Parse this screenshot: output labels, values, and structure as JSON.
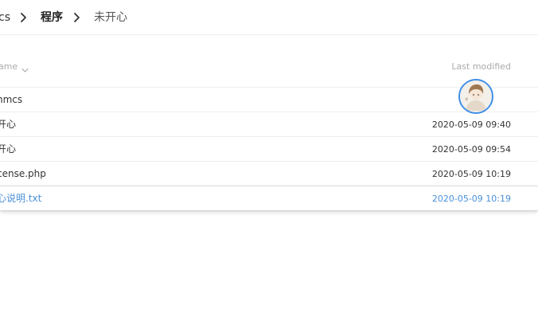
{
  "breadcrumb": {
    "items": [
      "cs",
      "程序",
      "未开心"
    ],
    "separator_icon": "chevron-right-icon"
  },
  "table": {
    "columns": {
      "name": "ame",
      "modified": "Last modified"
    },
    "sort_icon": "chevron-down-icon",
    "rows": [
      {
        "name": "nmcs",
        "modified": ""
      },
      {
        "name": "开心",
        "modified": "2020-05-09 09:40"
      },
      {
        "name": "开心",
        "modified": "2020-05-09 09:54"
      },
      {
        "name": "cense.php",
        "modified": "2020-05-09 10:19"
      },
      {
        "name": "心说明.txt",
        "modified": "2020-05-09 10:19",
        "selected": true
      }
    ]
  },
  "colors": {
    "accent": "#4a90d9",
    "avatar_ring": "#3e8fe8",
    "divider": "#eeeeee",
    "muted": "#aaaaaa"
  },
  "avatar": {
    "icon": "user-avatar"
  }
}
